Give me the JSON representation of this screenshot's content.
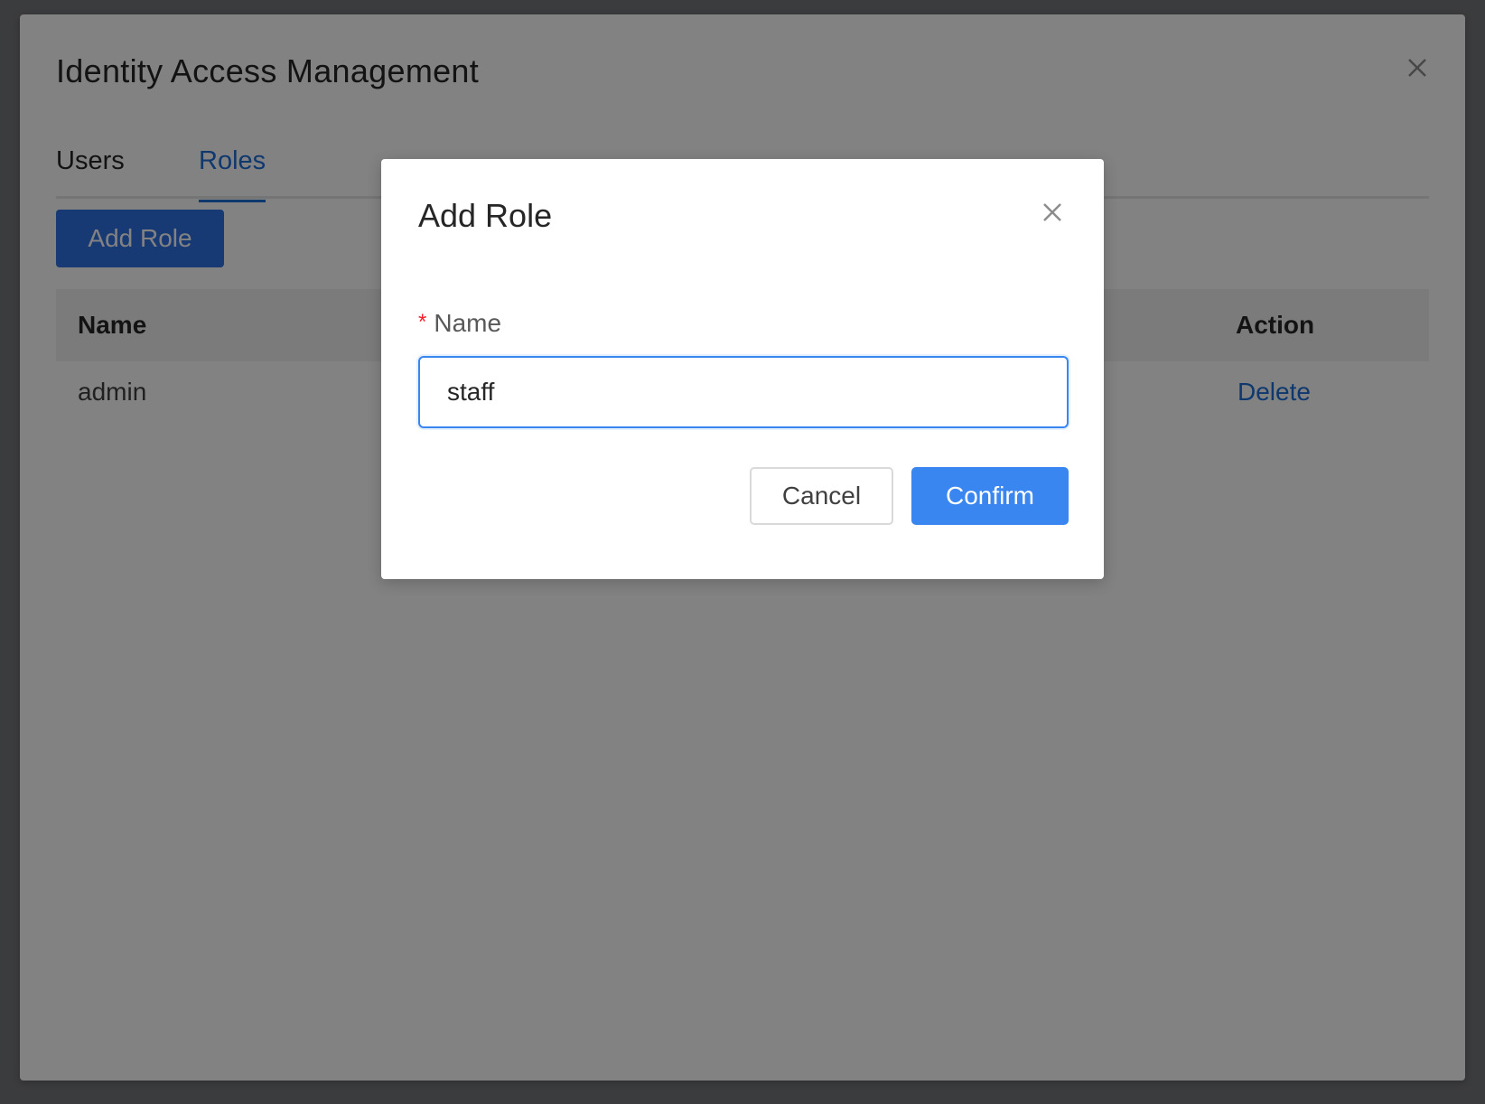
{
  "panel": {
    "title": "Identity Access Management",
    "close_icon": "close-icon",
    "tabs": [
      {
        "label": "Users",
        "active": false
      },
      {
        "label": "Roles",
        "active": true
      }
    ],
    "add_role_label": "Add Role",
    "table": {
      "columns": [
        "Name",
        "Action"
      ],
      "rows": [
        {
          "name": "admin",
          "action": "Delete"
        }
      ]
    }
  },
  "modal": {
    "title": "Add Role",
    "close_icon": "close-icon",
    "field": {
      "required_marker": "*",
      "label": "Name",
      "value": "staff"
    },
    "cancel_label": "Cancel",
    "confirm_label": "Confirm"
  },
  "colors": {
    "primary": "#3a86f0",
    "link": "#1e6fd9",
    "required": "#f5222d",
    "mask": "rgba(0,0,0,0.49)"
  }
}
